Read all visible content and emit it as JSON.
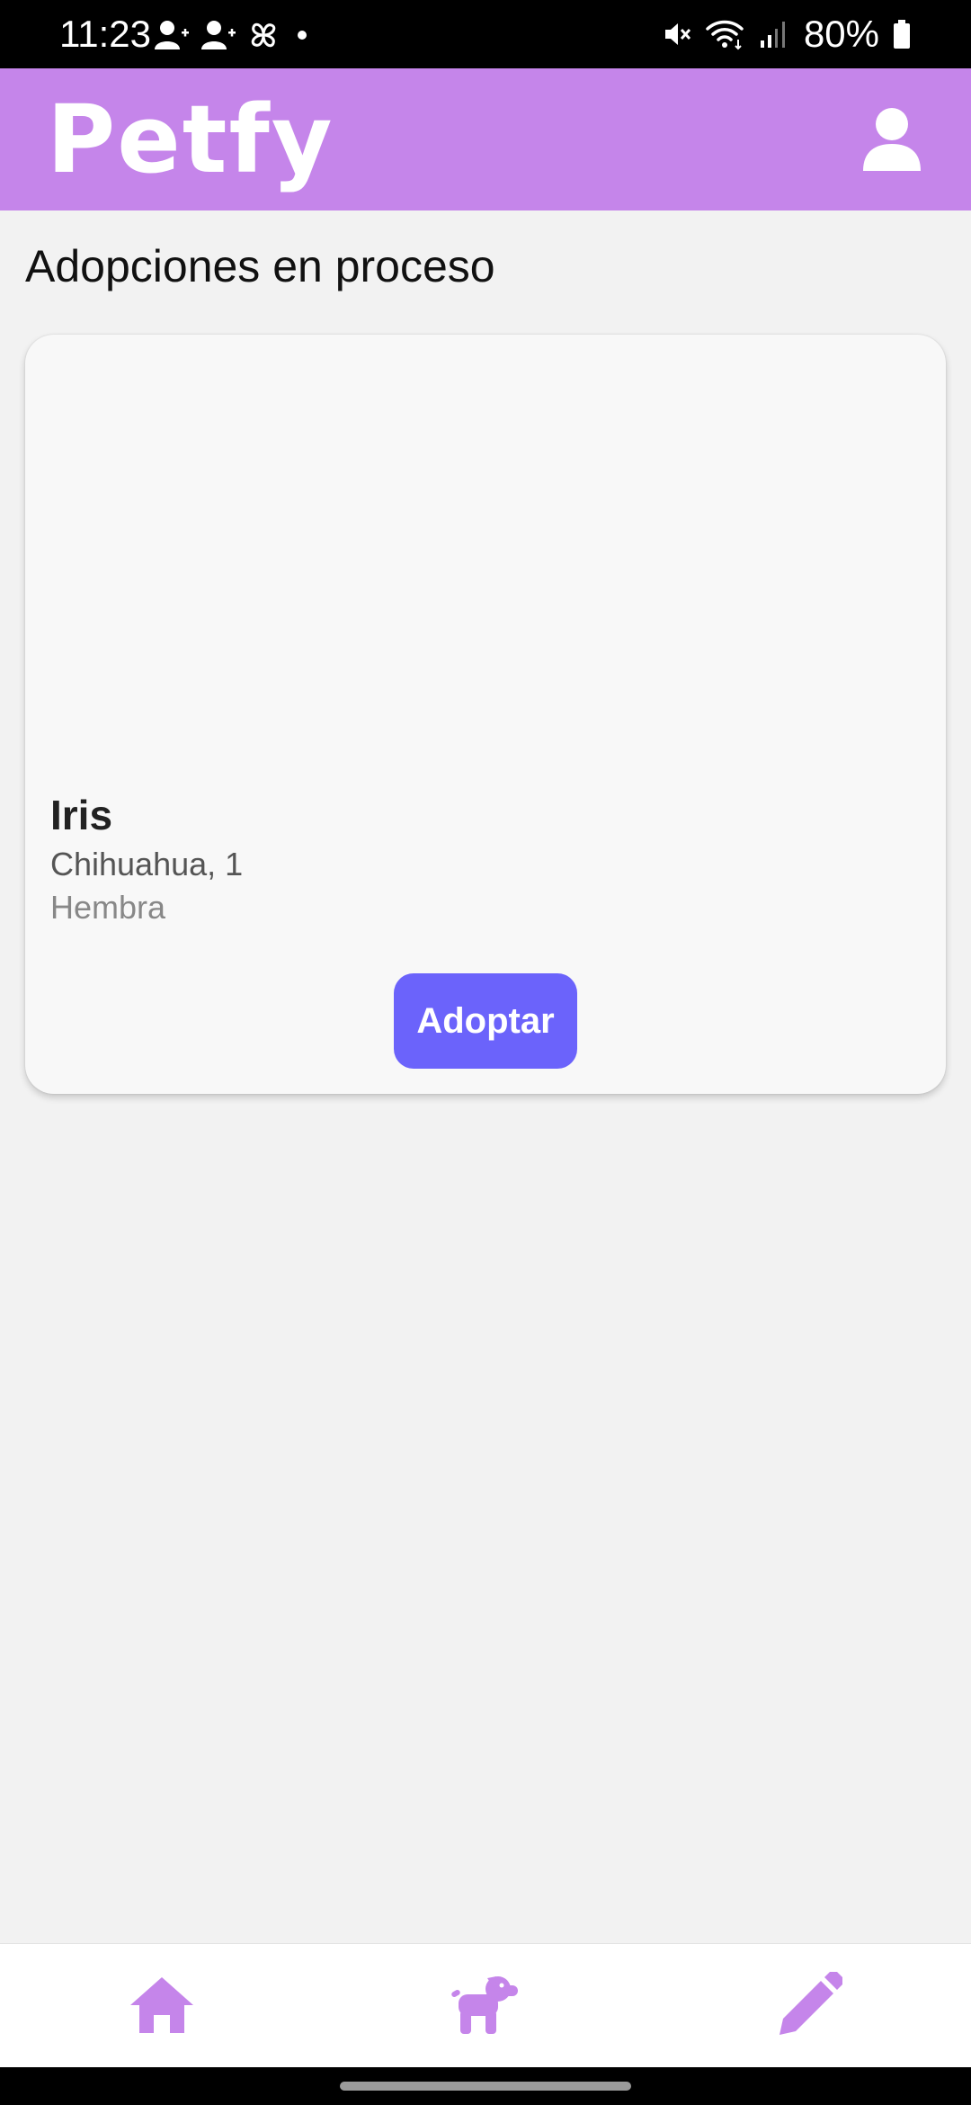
{
  "status_bar": {
    "time": "11:23",
    "battery": "80%",
    "icons": [
      "person-add-icon",
      "person-add-icon",
      "pinwheel-icon",
      "dot-icon",
      "mute-icon",
      "wifi-icon",
      "signal-icon",
      "battery-icon"
    ]
  },
  "header": {
    "app_name": "Petfy",
    "profile_icon": "person-icon",
    "background_color": "#c585ea"
  },
  "main": {
    "section_title": "Adopciones en proceso",
    "cards": [
      {
        "name": "Iris",
        "breed_age": "Chihuahua, 1",
        "sex": "Hembra",
        "button_label": "Adoptar",
        "button_color": "#6b63fb"
      }
    ]
  },
  "bottom_nav": {
    "items": [
      {
        "icon": "home-icon"
      },
      {
        "icon": "dog-icon"
      },
      {
        "icon": "pencil-icon"
      }
    ],
    "icon_color": "#c585ea"
  }
}
